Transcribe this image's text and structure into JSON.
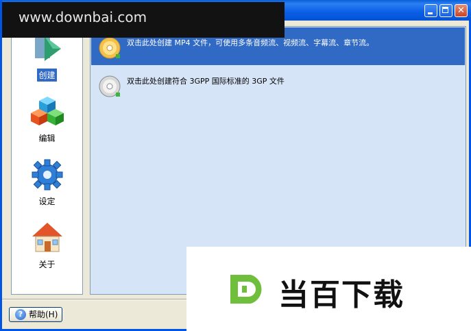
{
  "window": {
    "controls": {
      "minimize_icon": "minimize-icon",
      "maximize_icon": "maximize-icon",
      "close_icon": "close-icon"
    },
    "accent_color": "#0a5ee6"
  },
  "sidebar": {
    "items": [
      {
        "label": "创建",
        "icon": "create-media-icon",
        "selected": true
      },
      {
        "label": "编辑",
        "icon": "cubes-edit-icon",
        "selected": false
      },
      {
        "label": "设定",
        "icon": "gear-settings-icon",
        "selected": false
      },
      {
        "label": "关于",
        "icon": "house-about-icon",
        "selected": false
      }
    ]
  },
  "main": {
    "items": [
      {
        "text": "双击此处创建 MP4 文件，可使用多条音频流、视频流、字幕流、章节流。",
        "icon": "gold-disc-icon",
        "selected": true
      },
      {
        "text": "双击此处创建符合 3GPP 国际标准的 3GP 文件",
        "icon": "silver-disc-icon",
        "selected": false
      }
    ],
    "selection_color": "#316ac5",
    "background_color": "#d6e4f7"
  },
  "footer": {
    "help_label": "帮助(H)",
    "help_icon": "help-icon"
  },
  "watermark": {
    "site_text": "www.downbai.com",
    "brand_text": "当百下载",
    "brand_logo_icon": "downbai-logo-icon"
  }
}
